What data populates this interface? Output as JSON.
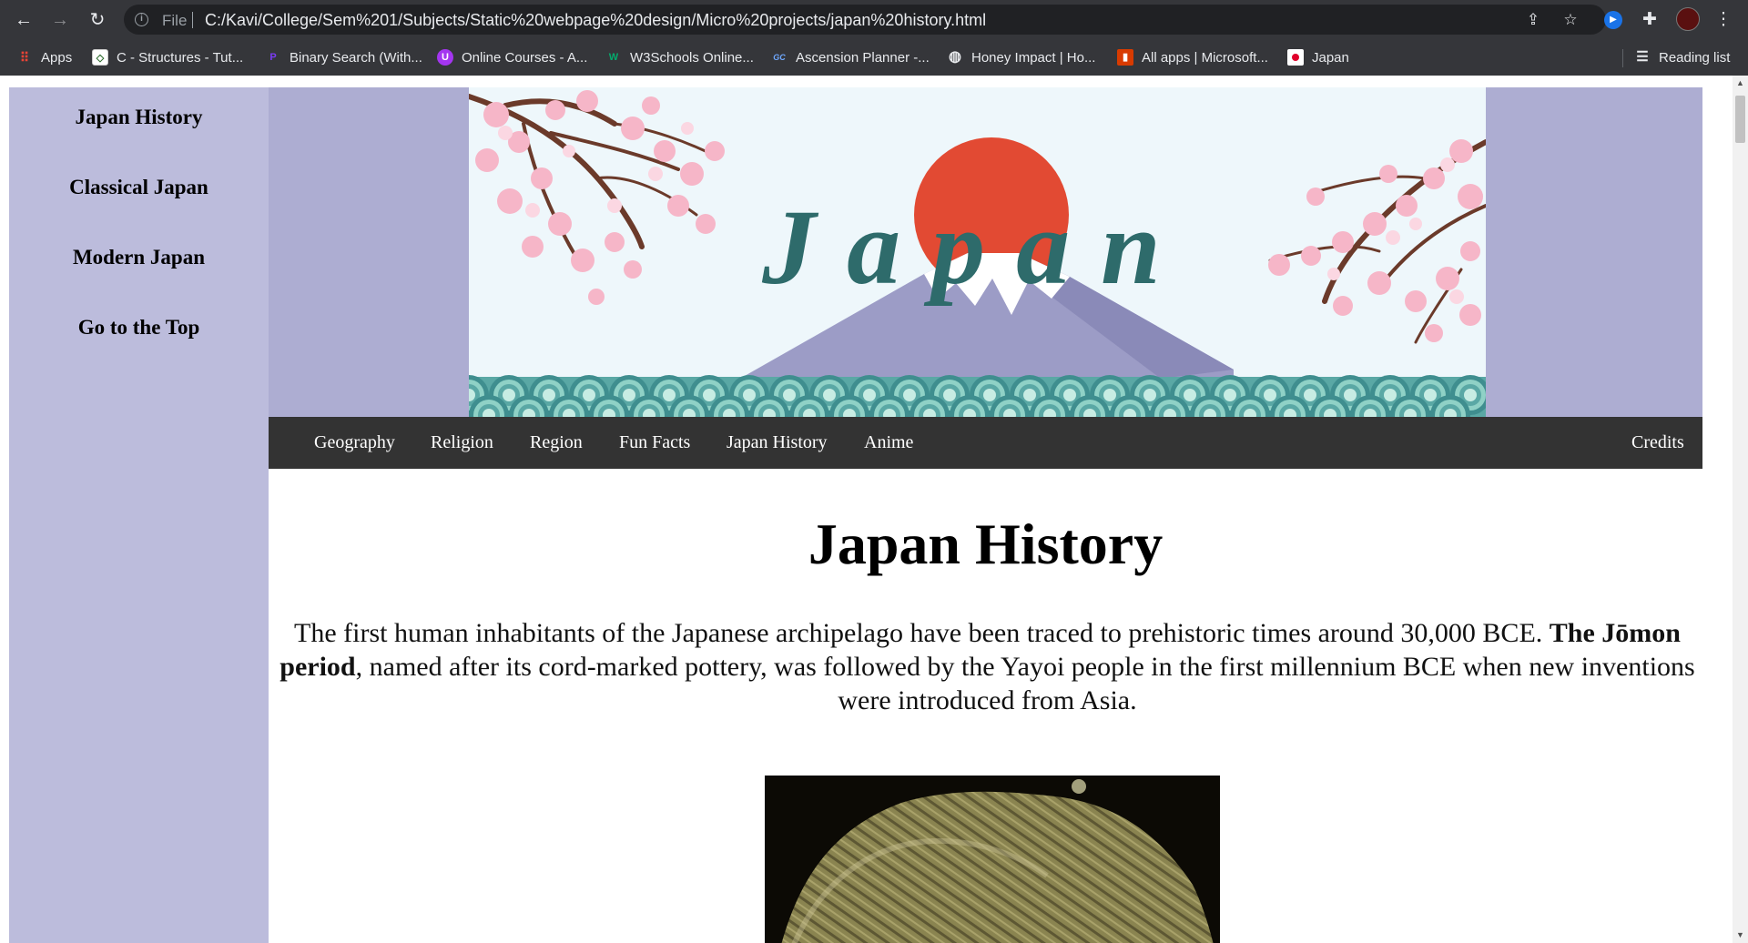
{
  "browser": {
    "file_label": "File",
    "url": "C:/Kavi/College/Sem%201/Subjects/Static%20webpage%20design/Micro%20projects/japan%20history.html",
    "bookmarks": [
      {
        "label": "Apps",
        "icon": "apps-grid-icon"
      },
      {
        "label": "C - Structures - Tut...",
        "icon": "tutorial-site-icon"
      },
      {
        "label": "Binary Search (With...",
        "icon": "programiz-icon"
      },
      {
        "label": "Online Courses - A...",
        "icon": "udemy-icon"
      },
      {
        "label": "W3Schools Online...",
        "icon": "w3schools-icon"
      },
      {
        "label": "Ascension Planner -...",
        "icon": "gc-icon"
      },
      {
        "label": "Honey Impact | Ho...",
        "icon": "globe-icon"
      },
      {
        "label": "All apps | Microsoft...",
        "icon": "office-icon"
      },
      {
        "label": "Japan",
        "icon": "japan-flag-icon"
      }
    ],
    "reading_list": "Reading list"
  },
  "sidebar": {
    "items": [
      {
        "label": "Japan History"
      },
      {
        "label": "Classical Japan"
      },
      {
        "label": "Modern Japan"
      },
      {
        "label": "Go to the Top"
      }
    ]
  },
  "banner": {
    "title": "Japan"
  },
  "topnav": {
    "items": [
      {
        "label": "Geography"
      },
      {
        "label": "Religion"
      },
      {
        "label": "Region"
      },
      {
        "label": "Fun Facts"
      },
      {
        "label": "Japan History"
      },
      {
        "label": "Anime"
      }
    ],
    "credits": "Credits"
  },
  "main": {
    "title": "Japan History",
    "intro_part1": "The first human inhabitants of the Japanese archipelago have been traced to prehistoric times around 30,000 BCE. ",
    "intro_bold": "The Jōmon period",
    "intro_part2": ", named after its cord-marked pottery, was followed by the Yayoi people in the first millennium BCE when new inventions were introduced from Asia."
  },
  "colors": {
    "chrome": "#35363a",
    "sidebar": "#bcbcdc",
    "banner_bg": "#adadd2",
    "nav_bar": "#333333",
    "sun": "#e24a33",
    "japan_text": "#2e6b6b"
  }
}
